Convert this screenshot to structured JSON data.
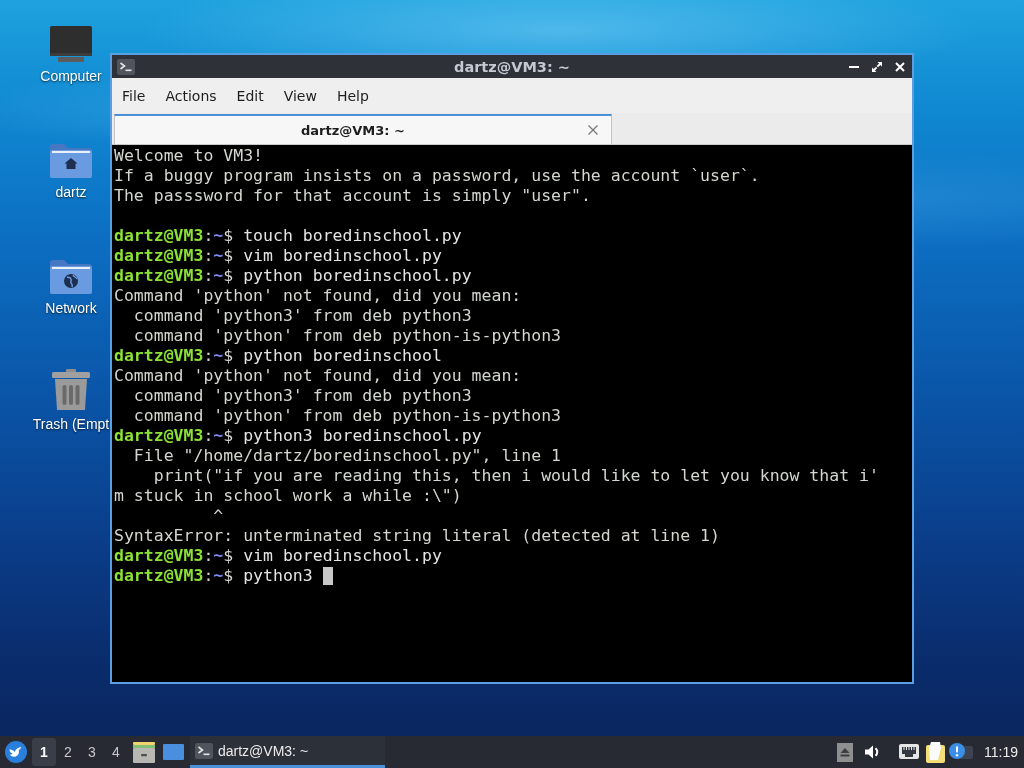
{
  "desktop": {
    "icons": [
      {
        "kind": "computer",
        "label": "Computer"
      },
      {
        "kind": "home",
        "label": "dartz"
      },
      {
        "kind": "network",
        "label": "Network"
      },
      {
        "kind": "trash",
        "label": "Trash (Empt"
      }
    ]
  },
  "window": {
    "title": "dartz@VM3: ~",
    "menu": [
      "File",
      "Actions",
      "Edit",
      "View",
      "Help"
    ],
    "tabs": [
      {
        "label": "dartz@VM3: ~",
        "selected": true
      }
    ],
    "terminal": {
      "cursor": true,
      "lines": [
        {
          "kind": "output",
          "text": "Welcome to VM3!"
        },
        {
          "kind": "output",
          "text": "If a buggy program insists on a password, use the account `user`."
        },
        {
          "kind": "output",
          "text": "The passsword for that account is simply \"user\"."
        },
        {
          "kind": "blank"
        },
        {
          "kind": "prompt",
          "user": "dartz@VM3",
          "separator": ":",
          "path": "~",
          "sign": "$",
          "command": "touch boredinschool.py"
        },
        {
          "kind": "prompt",
          "user": "dartz@VM3",
          "separator": ":",
          "path": "~",
          "sign": "$",
          "command": "vim boredinschool.py"
        },
        {
          "kind": "prompt",
          "user": "dartz@VM3",
          "separator": ":",
          "path": "~",
          "sign": "$",
          "command": "python boredinschool.py"
        },
        {
          "kind": "output",
          "text": "Command 'python' not found, did you mean:"
        },
        {
          "kind": "output",
          "text": "  command 'python3' from deb python3"
        },
        {
          "kind": "output",
          "text": "  command 'python' from deb python-is-python3"
        },
        {
          "kind": "prompt",
          "user": "dartz@VM3",
          "separator": ":",
          "path": "~",
          "sign": "$",
          "command": "python boredinschool"
        },
        {
          "kind": "output",
          "text": "Command 'python' not found, did you mean:"
        },
        {
          "kind": "output",
          "text": "  command 'python3' from deb python3"
        },
        {
          "kind": "output",
          "text": "  command 'python' from deb python-is-python3"
        },
        {
          "kind": "prompt",
          "user": "dartz@VM3",
          "separator": ":",
          "path": "~",
          "sign": "$",
          "command": "python3 boredinschool.py"
        },
        {
          "kind": "output",
          "text": "  File \"/home/dartz/boredinschool.py\", line 1"
        },
        {
          "kind": "output",
          "text": "    print(\"if you are reading this, then i would like to let you know that i'"
        },
        {
          "kind": "output",
          "text": "m stuck in school work a while :\\\")"
        },
        {
          "kind": "output",
          "text": "          ^"
        },
        {
          "kind": "output",
          "text": "SyntaxError: unterminated string literal (detected at line 1)"
        },
        {
          "kind": "prompt",
          "user": "dartz@VM3",
          "separator": ":",
          "path": "~",
          "sign": "$",
          "command": "vim boredinschool.py"
        },
        {
          "kind": "prompt",
          "user": "dartz@VM3",
          "separator": ":",
          "path": "~",
          "sign": "$",
          "command": "python3"
        }
      ]
    }
  },
  "taskbar": {
    "workspaces": [
      {
        "label": "1",
        "selected": true
      },
      {
        "label": "2",
        "selected": false
      },
      {
        "label": "3",
        "selected": false
      },
      {
        "label": "4",
        "selected": false
      }
    ],
    "tasks": [
      {
        "label": "dartz@VM3: ~",
        "active": true
      }
    ],
    "clock": "11:19"
  }
}
